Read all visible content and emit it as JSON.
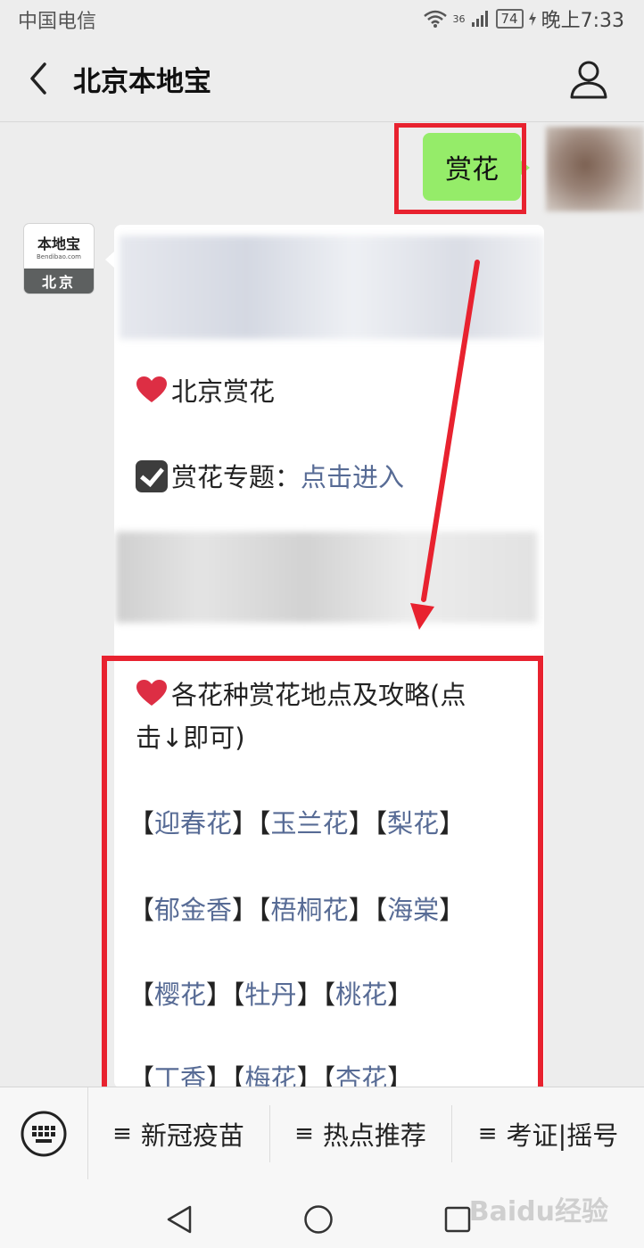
{
  "status_bar": {
    "carrier": "中国电信",
    "network": "36",
    "battery": "74",
    "time": "晚上7:33"
  },
  "nav": {
    "title": "北京本地宝"
  },
  "chat": {
    "user_message": "赏花",
    "bot_avatar": {
      "logo_text": "本地宝",
      "site": "Bendibao.com",
      "city": "北京"
    },
    "lines": {
      "heading1": "北京赏花",
      "topic_label": "赏花专题：",
      "topic_link": "点击进入",
      "heading2_line1": "各花种赏花地点及攻略(点",
      "heading2_line2": "击↓即可)"
    },
    "flower_rows": [
      [
        "迎春花",
        "玉兰花",
        "梨花"
      ],
      [
        "郁金香",
        "梧桐花",
        "海棠"
      ],
      [
        "樱花",
        "牡丹",
        "桃花"
      ],
      [
        "丁香",
        "梅花",
        "杏花"
      ]
    ]
  },
  "menu": {
    "items": [
      "新冠疫苗",
      "热点推荐",
      "考证|摇号"
    ],
    "prefix": "≡"
  },
  "watermark": "Baidu经验",
  "colors": {
    "accent_red": "#e8222f",
    "bubble_green": "#95ec69",
    "link_blue": "#576b95"
  }
}
